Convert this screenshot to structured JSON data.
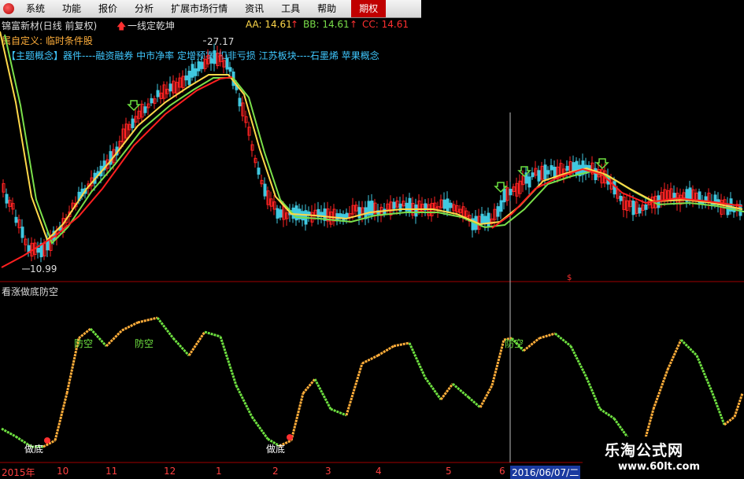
{
  "menu": [
    "系统",
    "功能",
    "报价",
    "分析",
    "扩展市场行情",
    "资讯",
    "工具",
    "帮助"
  ],
  "menu_active": "期权",
  "header": {
    "stock_title": "锦富新材(日线 前复权)",
    "formula_name": "一线定乾坤",
    "aa": "AA: 14.61",
    "bb": "BB: 14.61",
    "cc": "CC: 14.61",
    "custom": "属自定义: 临时条件股",
    "concepts": "【主题概念】器件----融资融券 中市净率 定增预案 扣非亏损 江苏板块----石墨烯 苹果概念"
  },
  "price_labels": {
    "high": "27.17",
    "low": "10.99"
  },
  "lower_panel": {
    "title": "看涨做底防空"
  },
  "annotations": {
    "fangkong": "防空",
    "zuodi": "做底"
  },
  "time_axis": {
    "labels": [
      "2015年",
      "10",
      "11",
      "12",
      "1",
      "2",
      "3",
      "4",
      "5",
      "6"
    ],
    "current": "2016/06/07/二"
  },
  "watermark": {
    "line1": "乐淘公式网",
    "line2": "www.60lt.com"
  },
  "colors": {
    "up": "#ff2222",
    "down": "#40c8e0",
    "ma1": "#ffd84a",
    "ma2": "#7adf4a",
    "ma3": "#ff2020",
    "osc_rise": "#ffae3a",
    "osc_fall": "#6ee040"
  }
}
